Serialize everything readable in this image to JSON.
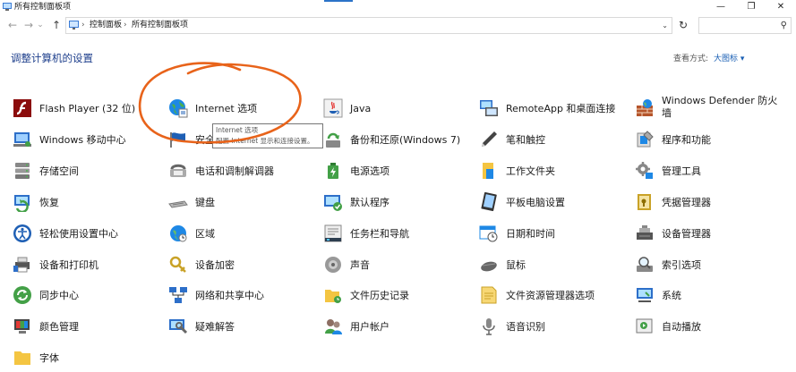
{
  "window": {
    "title": "所有控制面板项",
    "minimize_glyph": "—",
    "maximize_glyph": "❐",
    "close_glyph": "✕"
  },
  "nav": {
    "back_glyph": "←",
    "forward_glyph": "→",
    "history_glyph": "⌄",
    "up_glyph": "↑",
    "breadcrumbs": [
      "控制面板",
      "所有控制面板项"
    ],
    "separator": "›",
    "dropdown_glyph": "⌄",
    "refresh_glyph": "↻",
    "search_placeholder": "",
    "search_glyph": "⚲"
  },
  "header": {
    "title": "调整计算机的设置",
    "view_by_label": "查看方式:",
    "view_by_value": "大图标 ▾"
  },
  "tooltip": {
    "title": "Internet 选项",
    "text": "配置 Internet 显示和连接设置。"
  },
  "columns": [
    [
      {
        "label": "Flash Player (32 位)",
        "icon": "flash-icon"
      },
      {
        "label": "Windows 移动中心",
        "icon": "mobility-center-icon"
      },
      {
        "label": "存储空间",
        "icon": "storage-spaces-icon"
      },
      {
        "label": "恢复",
        "icon": "recovery-icon"
      },
      {
        "label": "轻松使用设置中心",
        "icon": "ease-of-access-icon"
      },
      {
        "label": "设备和打印机",
        "icon": "devices-printers-icon"
      },
      {
        "label": "同步中心",
        "icon": "sync-center-icon"
      },
      {
        "label": "颜色管理",
        "icon": "color-management-icon"
      },
      {
        "label": "字体",
        "icon": "fonts-icon"
      }
    ],
    [
      {
        "label": "Internet 选项",
        "icon": "internet-options-icon"
      },
      {
        "label": "安全",
        "icon": "security-flag-icon"
      },
      {
        "label": "电话和调制解调器",
        "icon": "phone-modem-icon"
      },
      {
        "label": "键盘",
        "icon": "keyboard-icon"
      },
      {
        "label": "区域",
        "icon": "region-icon"
      },
      {
        "label": "设备加密",
        "icon": "device-encryption-icon"
      },
      {
        "label": "网络和共享中心",
        "icon": "network-sharing-icon"
      },
      {
        "label": "疑难解答",
        "icon": "troubleshooting-icon"
      }
    ],
    [
      {
        "label": "Java",
        "icon": "java-icon"
      },
      {
        "label": "备份和还原(Windows 7)",
        "icon": "backup-restore-icon"
      },
      {
        "label": "电源选项",
        "icon": "power-options-icon"
      },
      {
        "label": "默认程序",
        "icon": "default-programs-icon"
      },
      {
        "label": "任务栏和导航",
        "icon": "taskbar-navigation-icon"
      },
      {
        "label": "声音",
        "icon": "sound-icon"
      },
      {
        "label": "文件历史记录",
        "icon": "file-history-icon"
      },
      {
        "label": "用户帐户",
        "icon": "user-accounts-icon"
      }
    ],
    [
      {
        "label": "RemoteApp 和桌面连接",
        "icon": "remoteapp-icon"
      },
      {
        "label": "笔和触控",
        "icon": "pen-touch-icon"
      },
      {
        "label": "工作文件夹",
        "icon": "work-folders-icon"
      },
      {
        "label": "平板电脑设置",
        "icon": "tablet-settings-icon"
      },
      {
        "label": "日期和时间",
        "icon": "date-time-icon"
      },
      {
        "label": "鼠标",
        "icon": "mouse-icon"
      },
      {
        "label": "文件资源管理器选项",
        "icon": "file-explorer-options-icon"
      },
      {
        "label": "语音识别",
        "icon": "speech-recognition-icon"
      }
    ],
    [
      {
        "label": "Windows Defender 防火墙",
        "icon": "firewall-icon"
      },
      {
        "label": "程序和功能",
        "icon": "programs-features-icon"
      },
      {
        "label": "管理工具",
        "icon": "admin-tools-icon"
      },
      {
        "label": "凭据管理器",
        "icon": "credential-manager-icon"
      },
      {
        "label": "设备管理器",
        "icon": "device-manager-icon"
      },
      {
        "label": "索引选项",
        "icon": "indexing-options-icon"
      },
      {
        "label": "系统",
        "icon": "system-icon"
      },
      {
        "label": "自动播放",
        "icon": "autoplay-icon"
      }
    ]
  ]
}
